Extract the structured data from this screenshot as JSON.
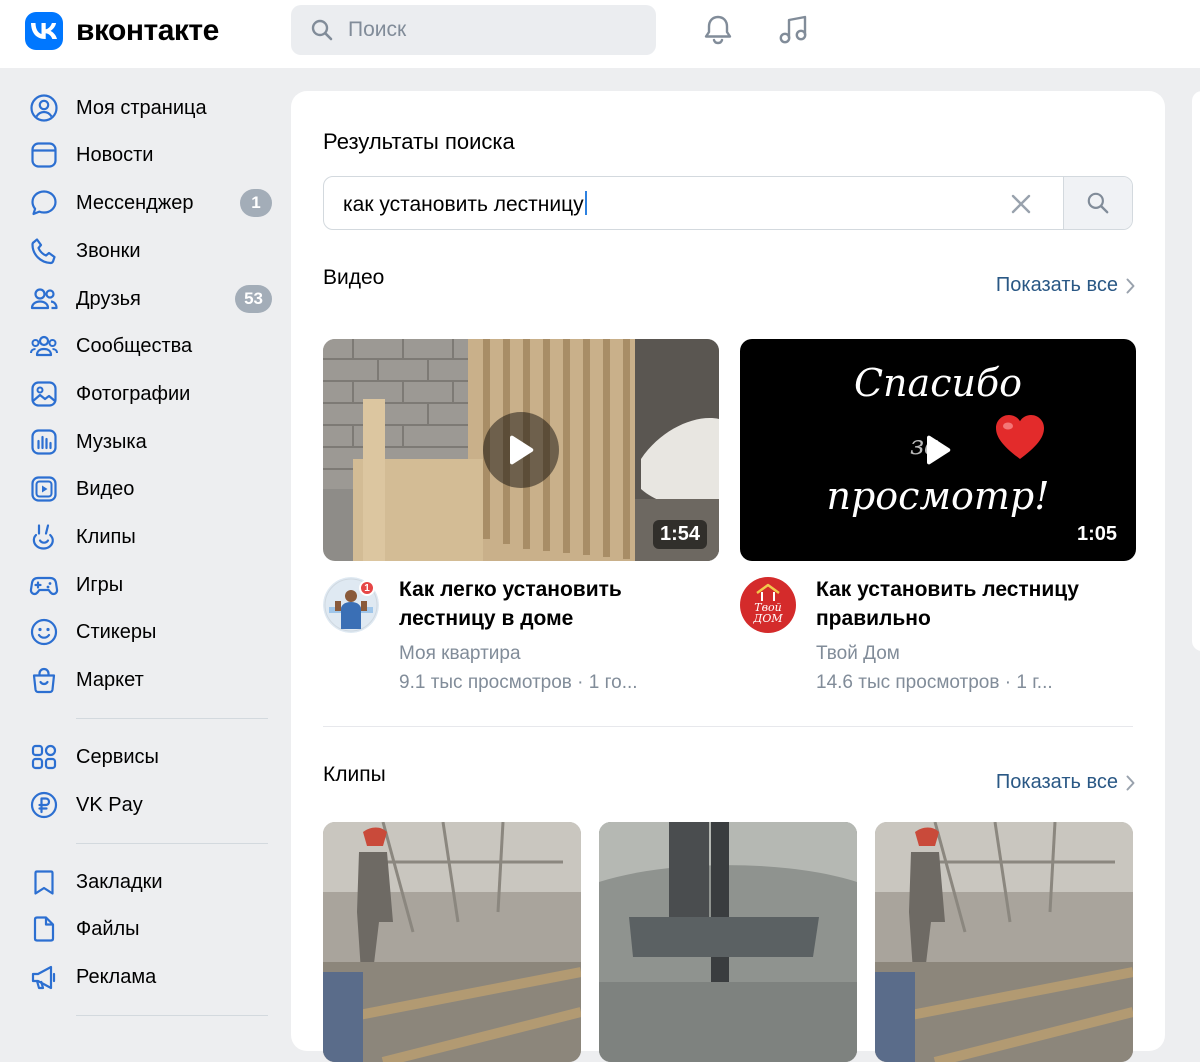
{
  "header": {
    "logo_text": "вконтакте",
    "search_placeholder": "Поиск"
  },
  "sidebar": {
    "items": [
      {
        "label": "Моя страница",
        "icon": "user-circle-icon"
      },
      {
        "label": "Новости",
        "icon": "news-icon"
      },
      {
        "label": "Мессенджер",
        "icon": "message-icon",
        "badge": "1"
      },
      {
        "label": "Звонки",
        "icon": "phone-icon"
      },
      {
        "label": "Друзья",
        "icon": "friends-icon",
        "badge": "53"
      },
      {
        "label": "Сообщества",
        "icon": "communities-icon"
      },
      {
        "label": "Фотографии",
        "icon": "photo-icon"
      },
      {
        "label": "Музыка",
        "icon": "music-icon"
      },
      {
        "label": "Видео",
        "icon": "video-icon"
      },
      {
        "label": "Клипы",
        "icon": "clips-icon"
      },
      {
        "label": "Игры",
        "icon": "gamepad-icon"
      },
      {
        "label": "Стикеры",
        "icon": "smile-icon"
      },
      {
        "label": "Маркет",
        "icon": "market-bag-icon"
      },
      {
        "label": "Сервисы",
        "icon": "services-grid-icon"
      },
      {
        "label": "VK Pay",
        "icon": "ruble-icon"
      },
      {
        "label": "Закладки",
        "icon": "bookmark-icon"
      },
      {
        "label": "Файлы",
        "icon": "file-icon"
      },
      {
        "label": "Реклама",
        "icon": "megaphone-icon"
      }
    ]
  },
  "main": {
    "title": "Результаты поиска",
    "query": "как установить лестницу",
    "videos_section": {
      "title": "Видео",
      "show_all": "Показать все",
      "items": [
        {
          "title": "Как легко установить лестницу в доме",
          "author": "Моя квартира",
          "meta": "9.1 тыс просмотров · 1 го...",
          "duration": "1:54",
          "avatar_badge": "1"
        },
        {
          "title": "Как установить лестницу правильно",
          "author": "Твой Дом",
          "meta": "14.6 тыс просмотров · 1 г...",
          "duration": "1:05",
          "thumb_text_1": "Спасибо",
          "thumb_text_2": "за",
          "thumb_text_3": "просмотр!",
          "avatar_text_1": "Твой",
          "avatar_text_2": "ДОМ"
        }
      ]
    },
    "clips_section": {
      "title": "Клипы",
      "show_all": "Показать все"
    }
  },
  "colors": {
    "accent": "#0077ff",
    "link": "#2a5885",
    "icon": "#2c6fd1",
    "background": "#edeef0",
    "muted": "#818c99"
  }
}
